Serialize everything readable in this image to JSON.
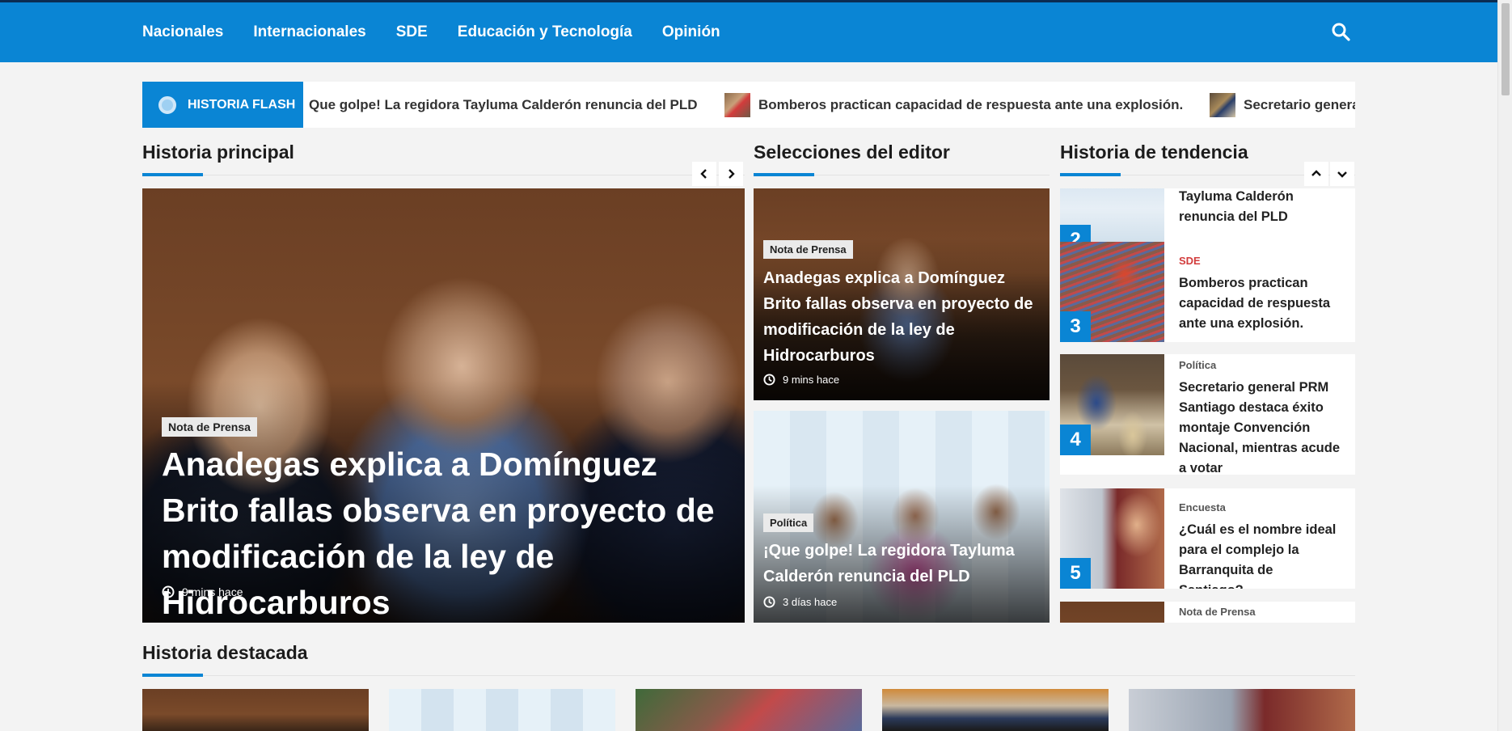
{
  "nav": {
    "items": [
      "Nacionales",
      "Internacionales",
      "SDE",
      "Educación y Tecnología",
      "Opinión"
    ],
    "search_icon": "search-icon"
  },
  "flash": {
    "label": "HISTORIA FLASH",
    "items": [
      "Que golpe! La regidora Tayluma Calderón renuncia del PLD",
      "Bomberos practican capacidad de respuesta ante una explosión.",
      "Secretario general"
    ]
  },
  "main": {
    "title": "Historia principal",
    "story": {
      "category": "Nota de Prensa",
      "headline": "Anadegas explica a Domínguez Brito fallas observa en proyecto de modificación de la ley de Hidrocarburos",
      "time": "9 mins hace"
    }
  },
  "editor": {
    "title": "Selecciones del editor",
    "items": [
      {
        "category": "Nota de Prensa",
        "headline": "Anadegas explica a Domínguez Brito fallas observa en proyecto de modificación de la ley de Hidrocarburos",
        "time": "9 mins hace"
      },
      {
        "category": "Política",
        "headline": "¡Que golpe! La regidora Tayluma Calderón renuncia del PLD",
        "time": "3 días hace"
      }
    ]
  },
  "trending": {
    "title": "Historia de tendencia",
    "items": [
      {
        "number": "2",
        "category": "",
        "title": "Tayluma Calderón renuncia del PLD"
      },
      {
        "number": "3",
        "category": "SDE",
        "title": "Bomberos practican capacidad de respuesta ante una explosión."
      },
      {
        "number": "4",
        "category": "Política",
        "title": "Secretario general PRM Santiago destaca éxito montaje Convención Nacional, mientras acude a votar"
      },
      {
        "number": "5",
        "category": "Encuesta",
        "title": "¿Cuál es el nombre ideal para el complejo la Barranquita de Santiago?"
      },
      {
        "number": "",
        "category": "Nota de Prensa",
        "title": ""
      }
    ]
  },
  "featured": {
    "title": "Historia destacada"
  },
  "colors": {
    "accent": "#0a85d4",
    "nav_top": "#0b2c52",
    "sde_red": "#d23c3c"
  }
}
